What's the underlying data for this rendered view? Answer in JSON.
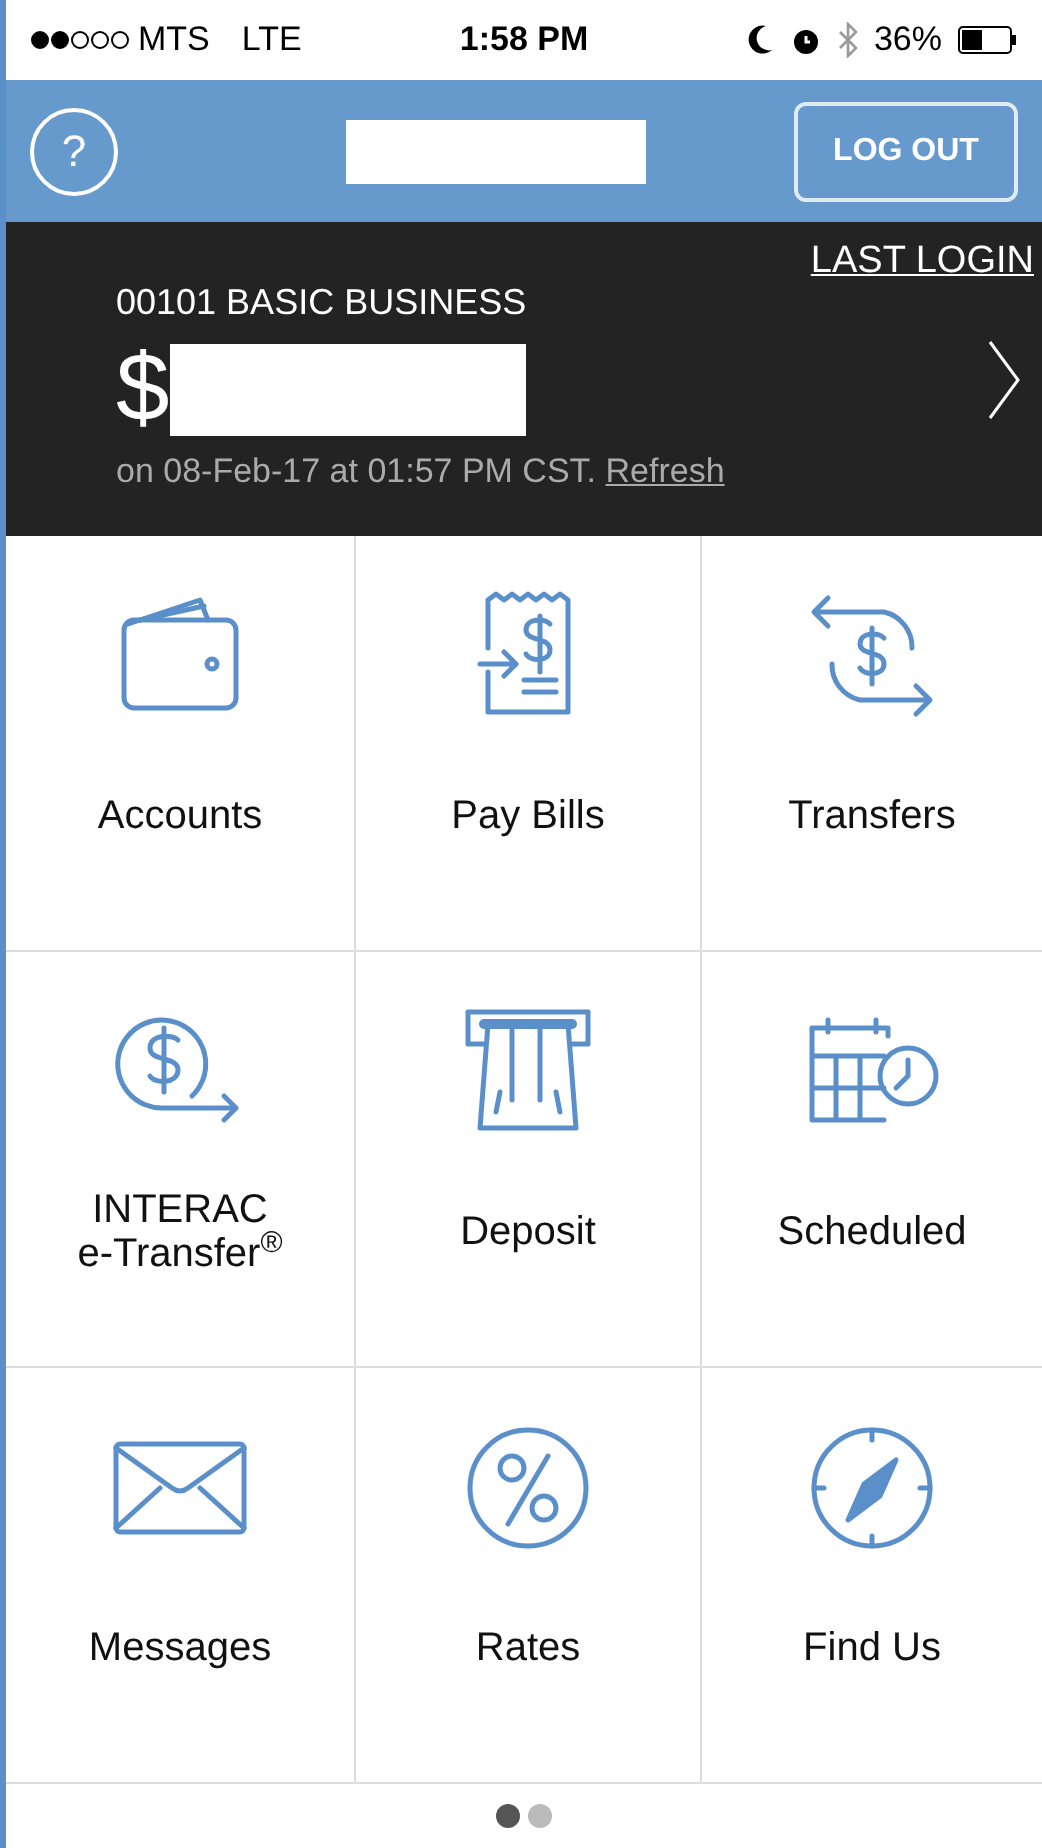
{
  "status_bar": {
    "carrier": "MTS",
    "network": "LTE",
    "time": "1:58 PM",
    "battery": "36%"
  },
  "header": {
    "help": "?",
    "logout": "LOG OUT"
  },
  "account": {
    "name": "00101 BASIC BUSINESS",
    "last_login": "LAST LOGIN",
    "currency": "$",
    "updated": "on 08-Feb-17 at 01:57 PM CST.",
    "refresh": "Refresh"
  },
  "tiles": [
    {
      "kind": "wallet",
      "label": "Accounts"
    },
    {
      "kind": "bill",
      "label": "Pay Bills"
    },
    {
      "kind": "transfer",
      "label": "Transfers"
    },
    {
      "kind": "etransfer",
      "label": "INTERAC\ne-Transfer$^{®}$"
    },
    {
      "kind": "deposit",
      "label": "Deposit"
    },
    {
      "kind": "calendar",
      "label": "Scheduled"
    },
    {
      "kind": "mail",
      "label": "Messages"
    },
    {
      "kind": "percent",
      "label": "Rates"
    },
    {
      "kind": "compass",
      "label": "Find Us"
    }
  ],
  "pages": [
    {
      "selected": true
    },
    {
      "selected": false
    }
  ]
}
